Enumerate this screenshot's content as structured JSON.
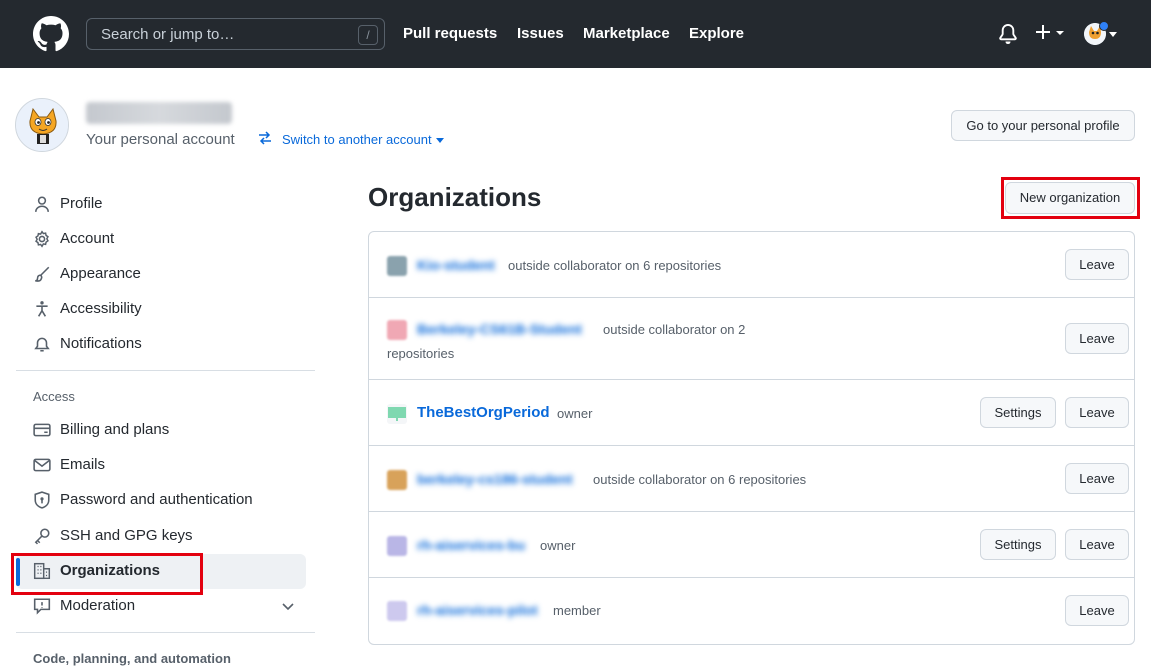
{
  "header": {
    "search_placeholder": "Search or jump to…",
    "search_shortcut": "/",
    "nav": [
      "Pull requests",
      "Issues",
      "Marketplace",
      "Explore"
    ]
  },
  "account": {
    "subtitle": "Your personal account",
    "switch_label": "Switch to another account",
    "go_profile_label": "Go to your personal profile"
  },
  "sidebar": {
    "items": [
      {
        "label": "Profile",
        "icon": "person-icon"
      },
      {
        "label": "Account",
        "icon": "gear-icon"
      },
      {
        "label": "Appearance",
        "icon": "paintbrush-icon"
      },
      {
        "label": "Accessibility",
        "icon": "accessibility-icon"
      },
      {
        "label": "Notifications",
        "icon": "bell-icon"
      }
    ],
    "access_heading": "Access",
    "access_items": [
      {
        "label": "Billing and plans",
        "icon": "credit-card-icon"
      },
      {
        "label": "Emails",
        "icon": "mail-icon"
      },
      {
        "label": "Password and authentication",
        "icon": "shield-lock-icon"
      },
      {
        "label": "SSH and GPG keys",
        "icon": "key-icon"
      },
      {
        "label": "Organizations",
        "icon": "organization-icon"
      },
      {
        "label": "Moderation",
        "icon": "report-icon"
      }
    ],
    "code_heading": "Code, planning, and automation"
  },
  "main": {
    "title": "Organizations",
    "new_org_label": "New organization",
    "leave_label": "Leave",
    "settings_label": "Settings",
    "orgs": [
      {
        "name": "Kio-student",
        "role": "outside collaborator on 6 repositories",
        "blurred": true
      },
      {
        "name": "Berkeley-CS61B-Student",
        "role": "outside collaborator on 2",
        "role_line2": "repositories",
        "blurred": true
      },
      {
        "name": "TheBestOrgPeriod",
        "role": "owner",
        "blurred": false
      },
      {
        "name": "berkeley-cs186-student",
        "role": "outside collaborator on 6 repositories",
        "blurred": true
      },
      {
        "name": "rh-aiservices-bu",
        "role": "owner",
        "blurred": true
      },
      {
        "name": "rh-aiservices-pilot",
        "role": "member",
        "blurred": true
      }
    ]
  },
  "colors": {
    "header_bg": "#24292f",
    "link": "#0969da",
    "highlight": "#e3000f"
  }
}
